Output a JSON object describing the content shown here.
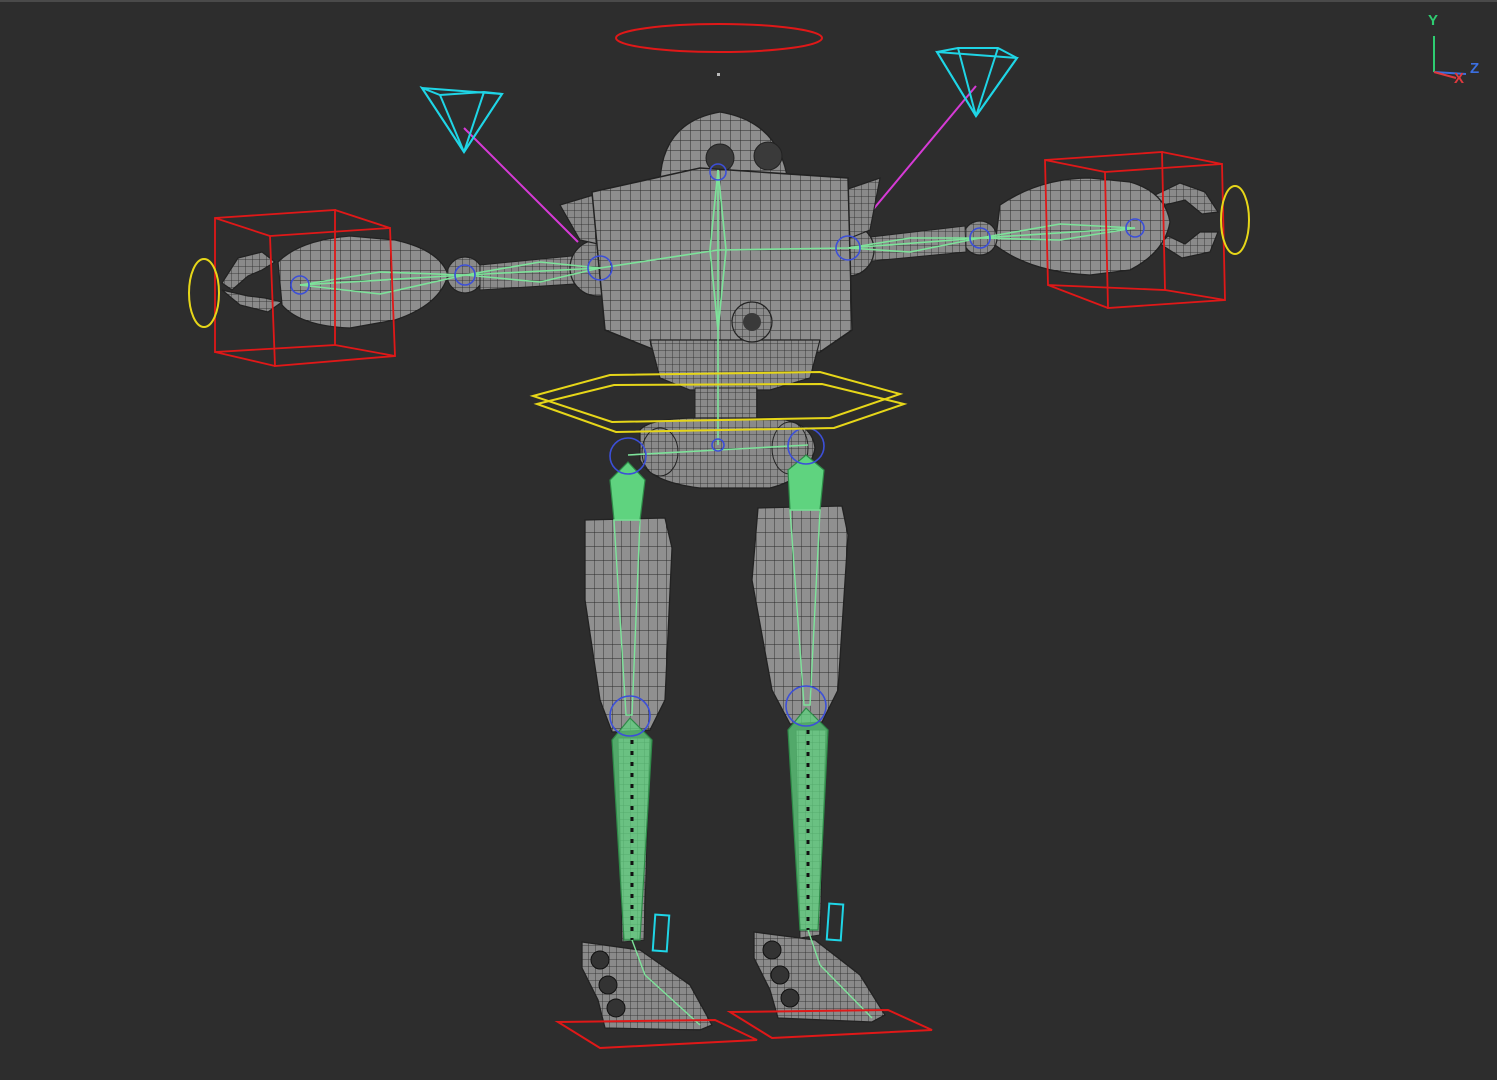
{
  "viewport": {
    "background": "#2d2d2d",
    "axis_gizmo": {
      "y_label": "Y",
      "x_label": "X",
      "z_label": "Z",
      "y_color": "#2ecc71",
      "x_color": "#e0393e",
      "z_color": "#3b6fe0"
    }
  },
  "rig_colors": {
    "mesh_wire": "#1a1a1a",
    "mesh_fill": "#8c8c8c",
    "bone": "#7de39a",
    "ik_box": "#e01818",
    "ring_control": "#e6d619",
    "target_cone": "#1fd5e6",
    "pole_line": "#d63ad6",
    "joint": "#3c4fd8",
    "foot_pad": "#e01818"
  }
}
